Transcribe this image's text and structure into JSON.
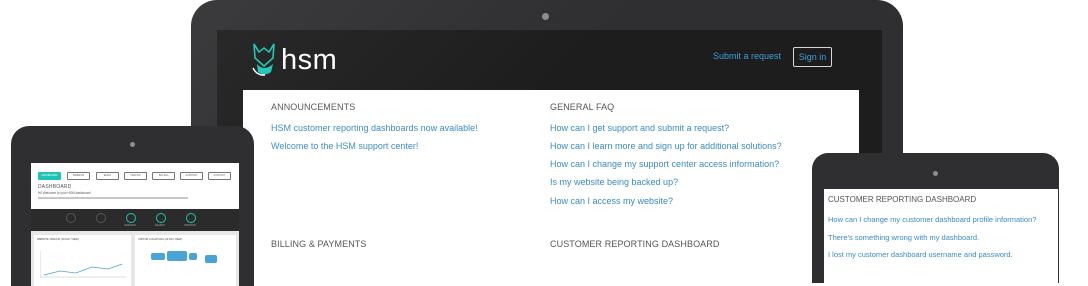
{
  "header": {
    "brand": "hsm",
    "submit_request": "Submit a request",
    "sign_in": "Sign in"
  },
  "sections": {
    "announcements": {
      "title": "ANNOUNCEMENTS",
      "items": [
        "HSM customer reporting dashboards now available!",
        "Welcome to the HSM support center!"
      ]
    },
    "general_faq": {
      "title": "GENERAL FAQ",
      "items": [
        "How can I get support and submit a request?",
        "How can I learn more and sign up for additional solutions?",
        "How can I change my support center access information?",
        "Is my website being backed up?",
        "How can I access my website?"
      ]
    },
    "billing": {
      "title": "BILLING & PAYMENTS"
    },
    "customer_reporting": {
      "title": "CUSTOMER REPORTING DASHBOARD"
    }
  },
  "tablet_right": {
    "title": "CUSTOMER REPORTING DASHBOARD",
    "items": [
      "How can I change my customer dashboard profile information?",
      "There's something wrong with my dashboard.",
      "I lost my customer dashboard username and password."
    ]
  },
  "tablet_left": {
    "tabs": [
      "DASHBOARD",
      "WEBSITE",
      "EMAIL",
      "TRAFFIC",
      "BILLING",
      "SUPPORT",
      "CONTACT"
    ],
    "title": "DASHBOARD",
    "subtitle": "Hi! Welcome to your HSM dashboard",
    "circles": [
      "",
      "",
      "MAINTAIN",
      "SEARCH",
      "MONITOR"
    ],
    "panel_left": "WEBSITE TRAFFIC (30 DAY VIEW)",
    "panel_right": "VISITOR LOCATIONS (30 DAY VIEW)"
  },
  "colors": {
    "accent": "#1ec4b3",
    "link": "#3a8bc4",
    "dark": "#1d1d1e"
  }
}
